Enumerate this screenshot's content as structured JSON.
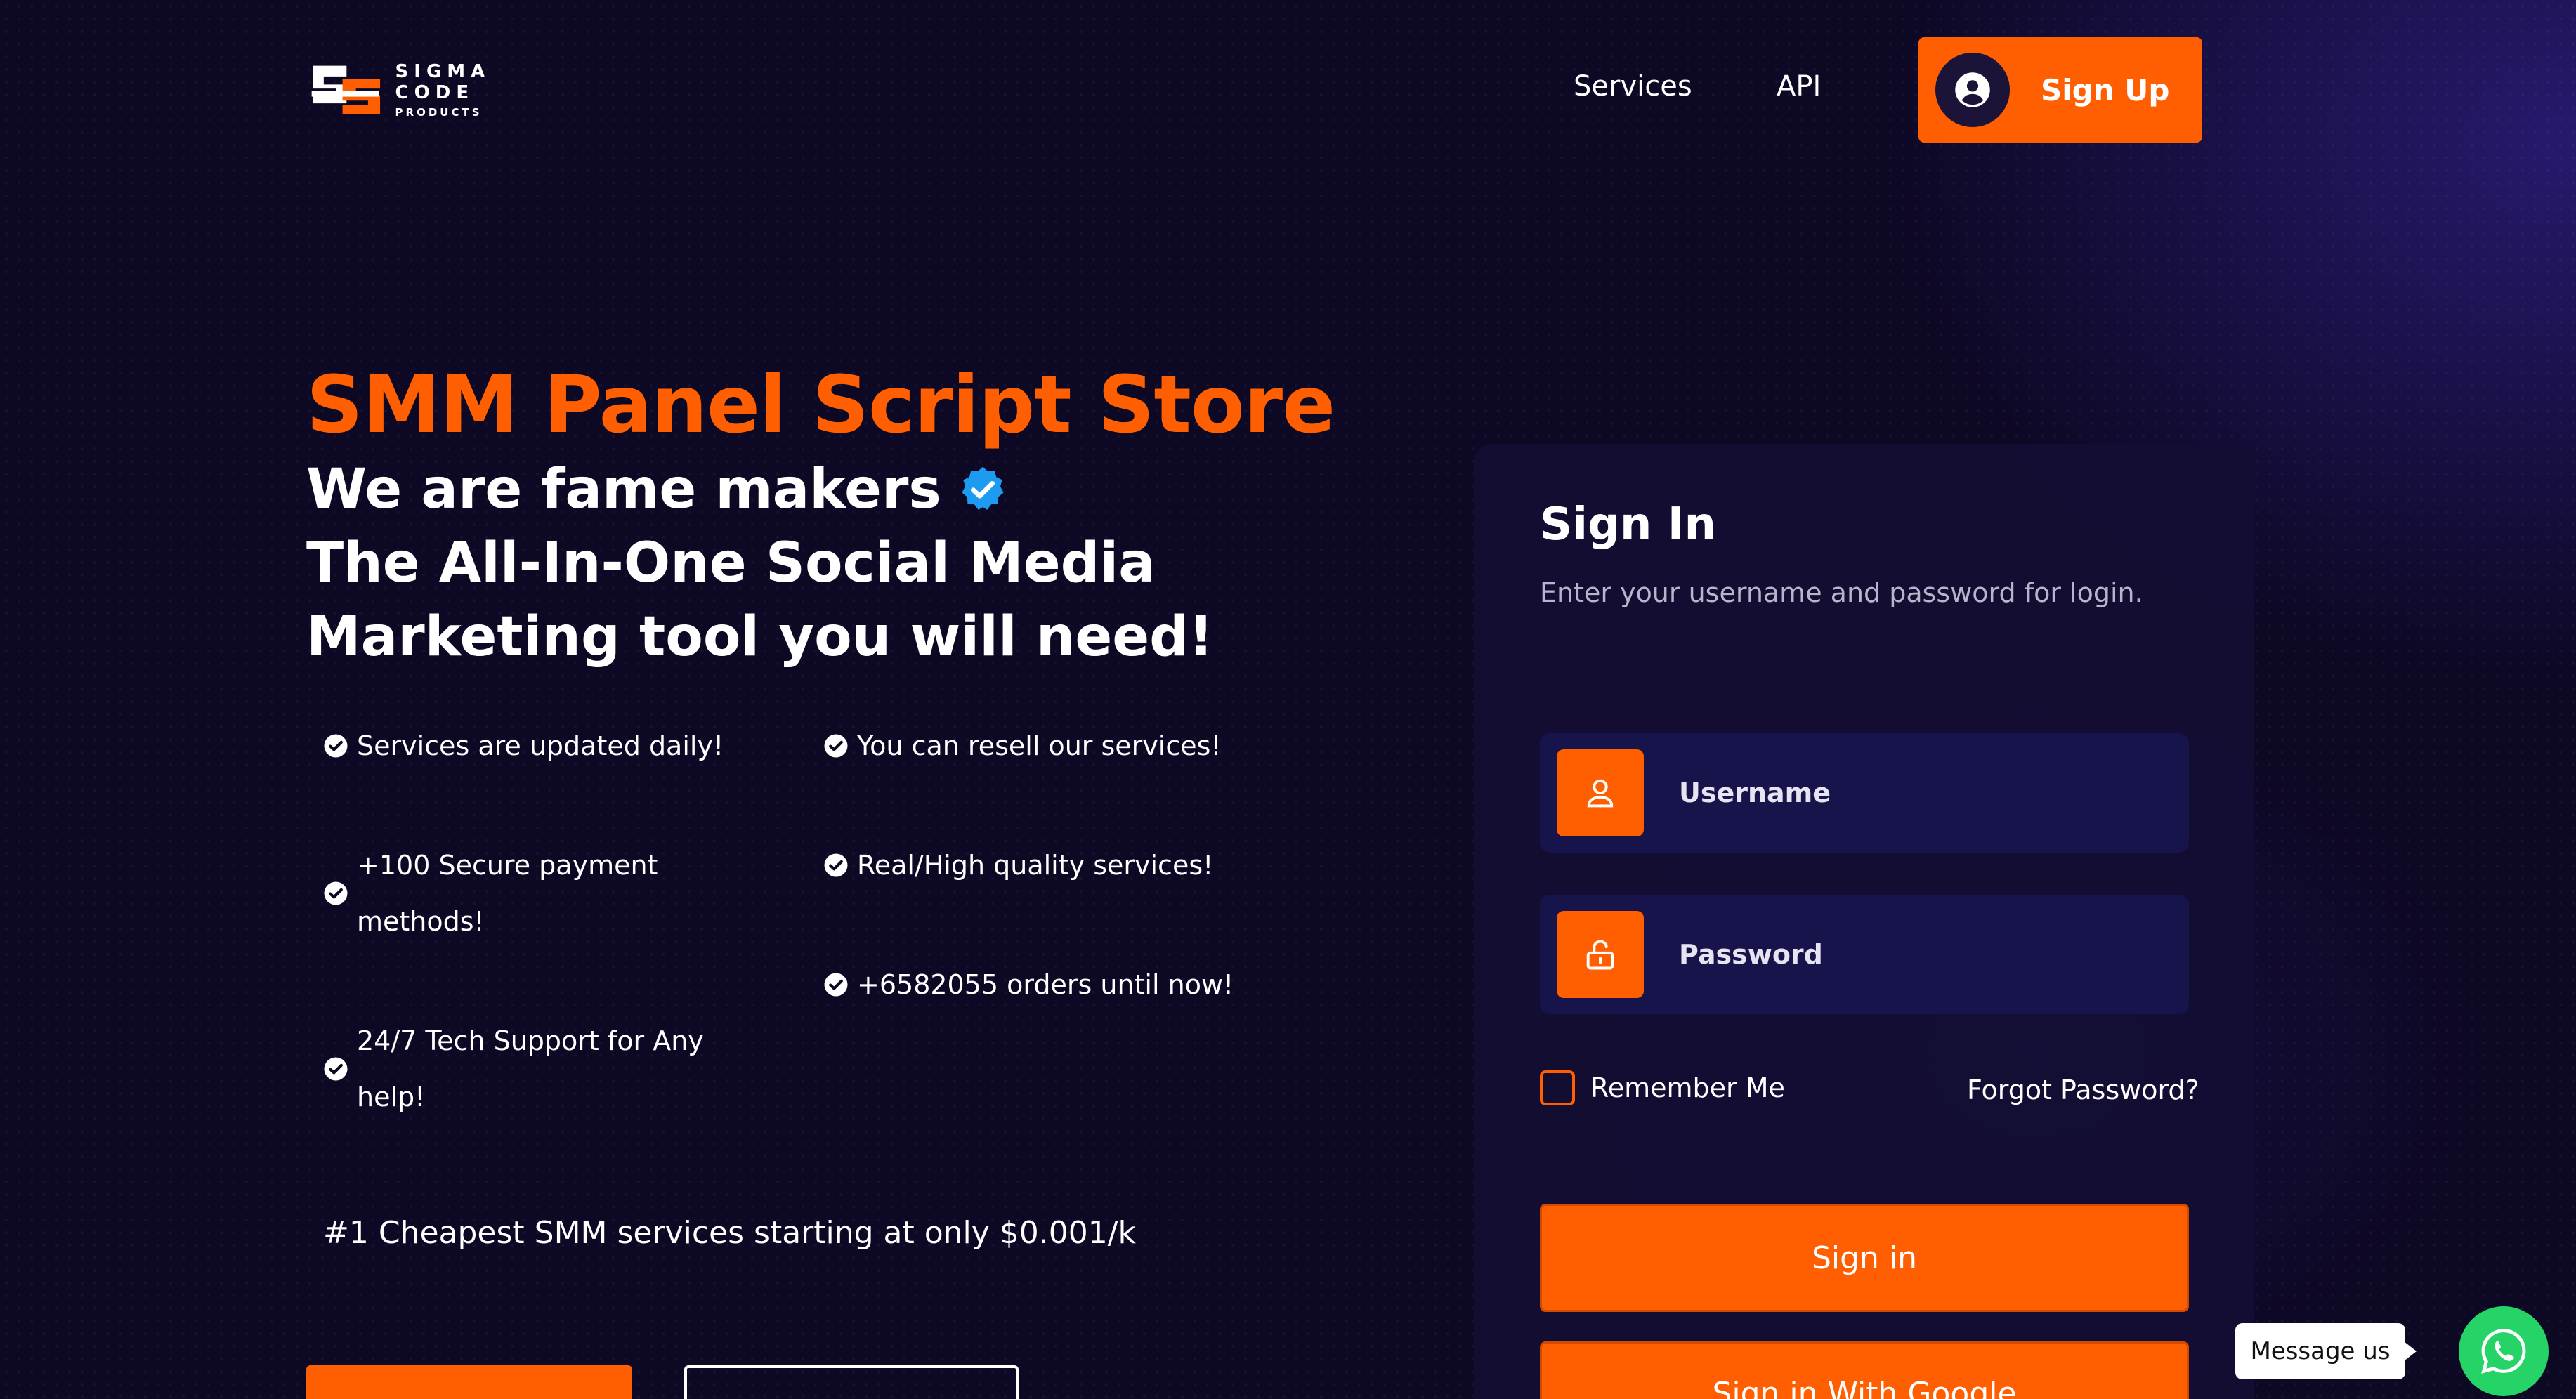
{
  "header": {
    "logo": {
      "name": "SIGMA CODE",
      "sub": "PRODUCTS"
    },
    "nav": [
      {
        "label": "Services"
      },
      {
        "label": "API"
      }
    ],
    "signup_label": "Sign Up"
  },
  "hero": {
    "title": "SMM Panel Script Store",
    "line1": "We are fame makers",
    "line2": "The All-In-One Social Media",
    "line3": "Marketing tool you will need!",
    "features": {
      "f1": "Services are updated daily!",
      "f2": "You can resell our services!",
      "f3a": "+100 Secure payment",
      "f3b": "methods!",
      "f4": "Real/High quality services!",
      "f5": "+6582055 orders until now!",
      "f6a": "24/7 Tech Support for Any",
      "f6b": "help!"
    },
    "cheapest": "#1 Cheapest SMM services starting at only $0.001/k"
  },
  "signin": {
    "title": "Sign In",
    "subtitle": "Enter your username and password for login.",
    "username_placeholder": "Username",
    "password_placeholder": "Password",
    "remember": "Remember Me",
    "forgot": "Forgot Password?",
    "signin_button": "Sign in",
    "google_button": "Sign in With Google"
  },
  "chat": {
    "bubble": "Message us"
  },
  "colors": {
    "accent": "#ff5f00",
    "background": "#0d0824",
    "field": "#16144a",
    "verified": "#1d9bf0",
    "whatsapp": "#25d366"
  }
}
